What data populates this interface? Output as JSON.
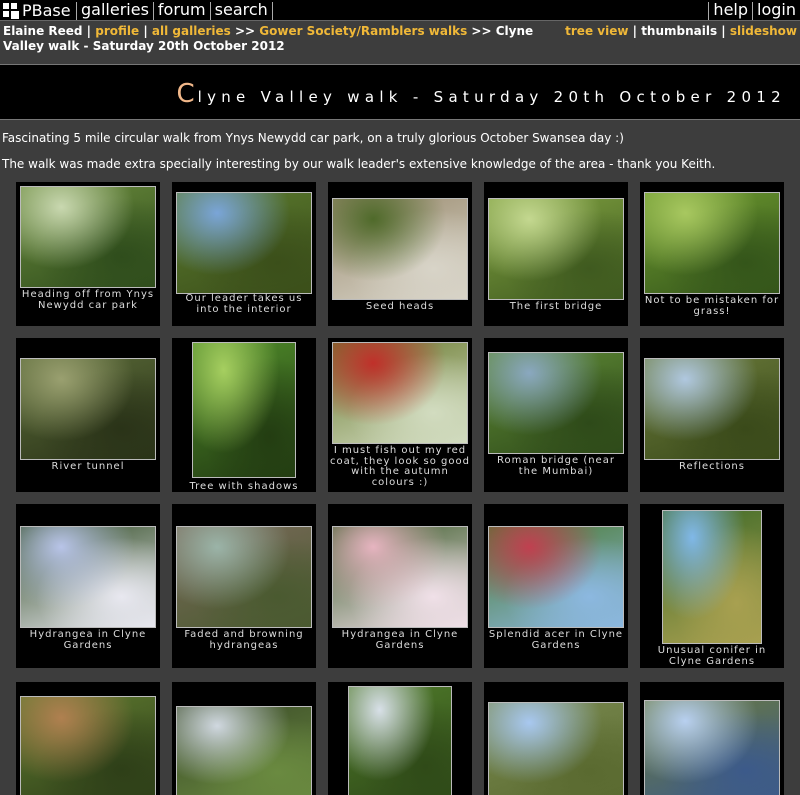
{
  "topbar": {
    "logo_text": "PBase",
    "left_links": [
      "galleries",
      "forum",
      "search"
    ],
    "right_links": [
      "help",
      "login"
    ]
  },
  "breadcrumb": {
    "owner": "Elaine Reed",
    "profile": "profile",
    "all_galleries": "all galleries",
    "sep": ">>",
    "parent": "Gower Society/Ramblers walks",
    "current": "Clyne Valley walk - Saturday 20th October 2012"
  },
  "views": {
    "tree": "tree view",
    "thumbs": "thumbnails",
    "slideshow": "slideshow"
  },
  "gallery": {
    "title_first": "C",
    "title_rest": "lyne Valley walk - Saturday 20th October 2012",
    "desc1": "Fascinating 5 mile circular walk from Ynys Newydd car park, on a truly glorious October Swansea day :)",
    "desc2": "The walk was made extra specially interesting by our walk leader's extensive knowledge of the area - thank you Keith."
  },
  "thumbs": [
    {
      "caption": "Heading off from Ynys Newydd car park",
      "colors": [
        "#6a8a3c",
        "#c9d8b0",
        "#2f4d1c"
      ]
    },
    {
      "caption": "Our leader takes us into the interior",
      "colors": [
        "#5b7a2e",
        "#7aa5d8",
        "#3b4f1a"
      ]
    },
    {
      "caption": "Seed heads",
      "colors": [
        "#9b8c70",
        "#4f6a2a",
        "#d8d4c8"
      ]
    },
    {
      "caption": "The first bridge",
      "colors": [
        "#7fa040",
        "#c4d890",
        "#3f5a1f"
      ]
    },
    {
      "caption": "Not to be mistaken for grass!",
      "colors": [
        "#6e9a30",
        "#a8c860",
        "#34551a"
      ]
    },
    {
      "caption": "River tunnel",
      "colors": [
        "#5a6a38",
        "#9aa070",
        "#2a3318"
      ]
    },
    {
      "caption": "Tree with shadows",
      "colors": [
        "#4f8a2a",
        "#a6cf60",
        "#233d12"
      ]
    },
    {
      "caption": "I must fish out my red coat, they look so good with the autumn colours :)",
      "colors": [
        "#6a7a30",
        "#c0302a",
        "#d2dcc0"
      ]
    },
    {
      "caption": "Roman bridge (near the Mumbai)",
      "colors": [
        "#5f8a36",
        "#8aa8c0",
        "#2e4a19"
      ]
    },
    {
      "caption": "Reflections",
      "colors": [
        "#6a7a3a",
        "#b0c8e0",
        "#3a4a1a"
      ]
    },
    {
      "caption": "Hydrangea in Clyne Gardens",
      "colors": [
        "#2f4a22",
        "#b8c4e8",
        "#e8e8f0"
      ]
    },
    {
      "caption": "Faded and browning hydrangeas",
      "colors": [
        "#7a6a5a",
        "#9bb4a8",
        "#4a5a30"
      ]
    },
    {
      "caption": "Hydrangea in Clyne Gardens",
      "colors": [
        "#3a5a28",
        "#e6b4c0",
        "#f0e0e8"
      ]
    },
    {
      "caption": "Splendid acer in Clyne Gardens",
      "colors": [
        "#4a7a30",
        "#c04050",
        "#8cb8e0"
      ]
    },
    {
      "caption": "Unusual conifer in Clyne Gardens",
      "colors": [
        "#3f6a28",
        "#80b8e8",
        "#a8a050"
      ]
    },
    {
      "caption": "",
      "colors": [
        "#5f7a30",
        "#b08050",
        "#2e3f18"
      ]
    },
    {
      "caption": "",
      "colors": [
        "#3a4a28",
        "#d0d8e0",
        "#6a8a40"
      ]
    },
    {
      "caption": "",
      "colors": [
        "#4f7a2a",
        "#d8e0e8",
        "#2f4a18"
      ]
    },
    {
      "caption": "",
      "colors": [
        "#7a8a50",
        "#a8c8f0",
        "#5a6a30"
      ]
    },
    {
      "caption": "",
      "colors": [
        "#6a7a40",
        "#b8d0f0",
        "#3c5a8a"
      ]
    }
  ]
}
